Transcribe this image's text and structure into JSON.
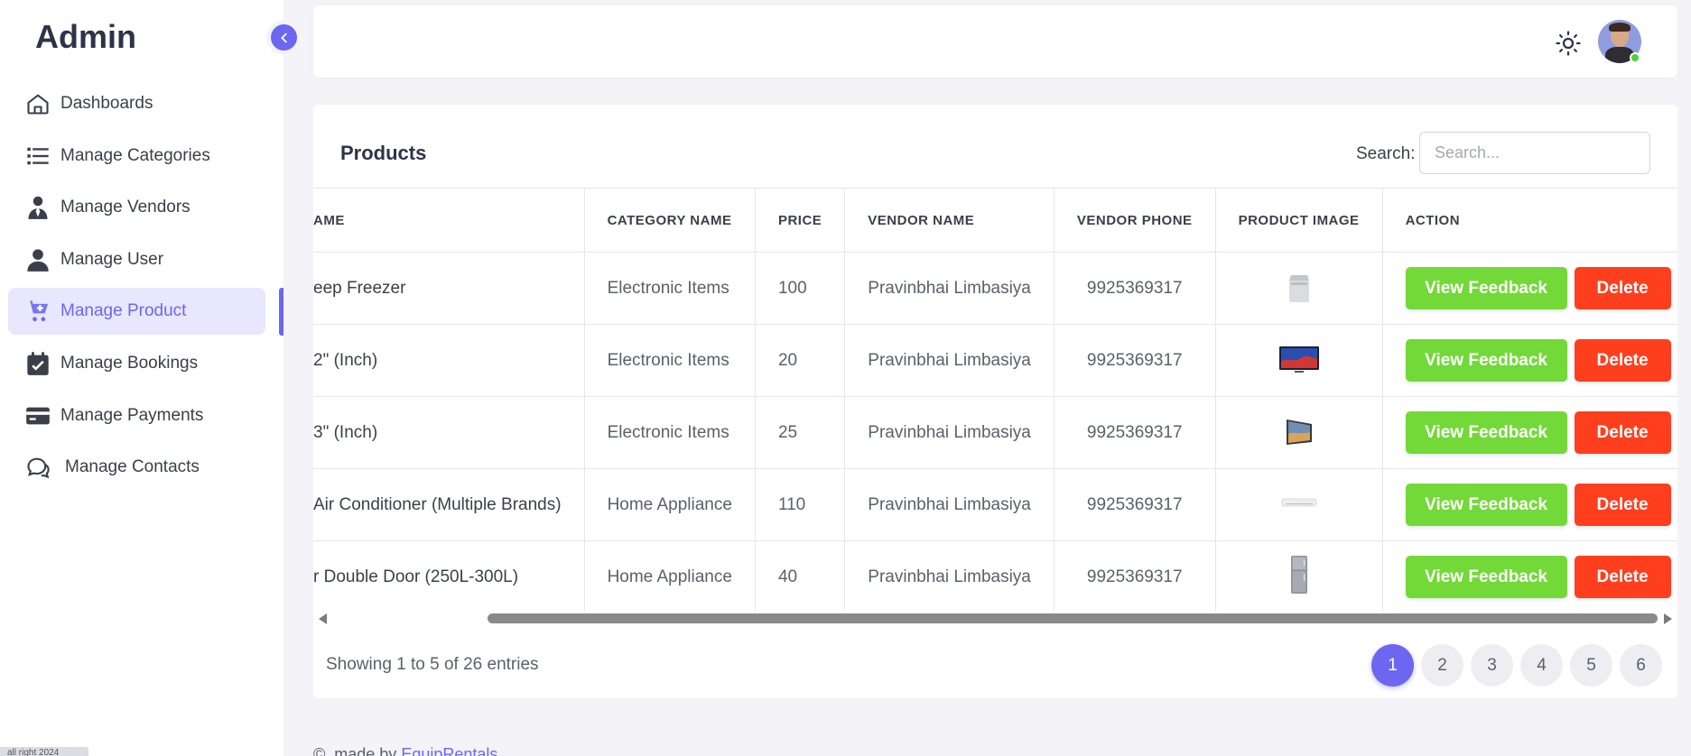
{
  "sidebar": {
    "brand": "Admin",
    "items": [
      {
        "label": "Dashboards",
        "icon": "home-icon"
      },
      {
        "label": "Manage Categories",
        "icon": "list-icon"
      },
      {
        "label": "Manage Vendors",
        "icon": "vendor-icon"
      },
      {
        "label": "Manage User",
        "icon": "user-icon"
      },
      {
        "label": "Manage Product",
        "icon": "cart-plus-icon",
        "active": true
      },
      {
        "label": "Manage Bookings",
        "icon": "calendar-check-icon"
      },
      {
        "label": "Manage Payments",
        "icon": "credit-card-icon"
      },
      {
        "label": "Manage Contacts",
        "icon": "chat-icon"
      }
    ],
    "copyright_tag": "all right 2024"
  },
  "colors": {
    "accent": "#6d67f0",
    "success": "#72d938",
    "danger": "#ff3e1d"
  },
  "products": {
    "title": "Products",
    "search_label": "Search:",
    "search_placeholder": "Search...",
    "search_value": "",
    "columns": [
      "AME",
      "CATEGORY NAME",
      "PRICE",
      "VENDOR NAME",
      "VENDOR PHONE",
      "PRODUCT IMAGE",
      "ACTION"
    ],
    "rows": [
      {
        "name": "eep Freezer",
        "category": "Electronic Items",
        "price": "100",
        "vendor": "Pravinbhai Limbasiya",
        "phone": "9925369317",
        "image": "freezer"
      },
      {
        "name": "2\" (Inch)",
        "category": "Electronic Items",
        "price": "20",
        "vendor": "Pravinbhai Limbasiya",
        "phone": "9925369317",
        "image": "tv"
      },
      {
        "name": "3\" (Inch)",
        "category": "Electronic Items",
        "price": "25",
        "vendor": "Pravinbhai Limbasiya",
        "phone": "9925369317",
        "image": "monitor"
      },
      {
        "name": "Air Conditioner (Multiple Brands)",
        "category": "Home Appliance",
        "price": "110",
        "vendor": "Pravinbhai Limbasiya",
        "phone": "9925369317",
        "image": "ac"
      },
      {
        "name": "r Double Door (250L-300L)",
        "category": "Home Appliance",
        "price": "40",
        "vendor": "Pravinbhai Limbasiya",
        "phone": "9925369317",
        "image": "fridge"
      }
    ],
    "actions": {
      "feedback_label": "View Feedback",
      "delete_label": "Delete"
    },
    "entries_text": "Showing 1 to 5 of 26 entries",
    "pages": [
      "1",
      "2",
      "3",
      "4",
      "5",
      "6"
    ],
    "current_page": "1"
  },
  "footer": {
    "prefix": "©, made by",
    "link_text": "EquipRentals"
  }
}
